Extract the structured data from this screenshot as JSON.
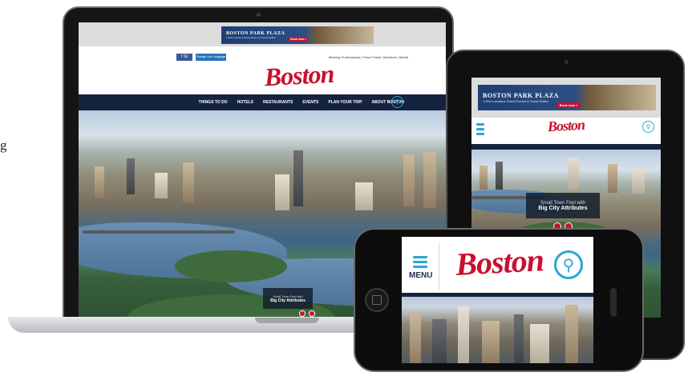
{
  "edge_text": "g",
  "ad": {
    "title": "BOSTON PARK PLAZA",
    "subtitle": "1,054 Luxurious Guest Rooms & Guest Suites",
    "button": "Book now »"
  },
  "brand": {
    "logo": "Boston",
    "accent": "#c8102e",
    "nav_color": "#15233f",
    "search_color": "#2aa6d6"
  },
  "laptop": {
    "share": "f 1k",
    "lang": "Change Your Language",
    "top_links": "Meeting Professionals | Travel Trade | Members | Media",
    "nav": [
      "THINGS TO DO",
      "HOTELS",
      "RESTAURANTS",
      "EVENTS",
      "PLAN YOUR TRIP",
      "ABOUT BOSTON"
    ]
  },
  "caption": {
    "line1": "Small Town Feel with",
    "line2": "Big City Attributes"
  },
  "phone": {
    "menu": "MENU"
  },
  "icons": {
    "search": "search-icon",
    "menu": "hamburger-menu-icon"
  }
}
